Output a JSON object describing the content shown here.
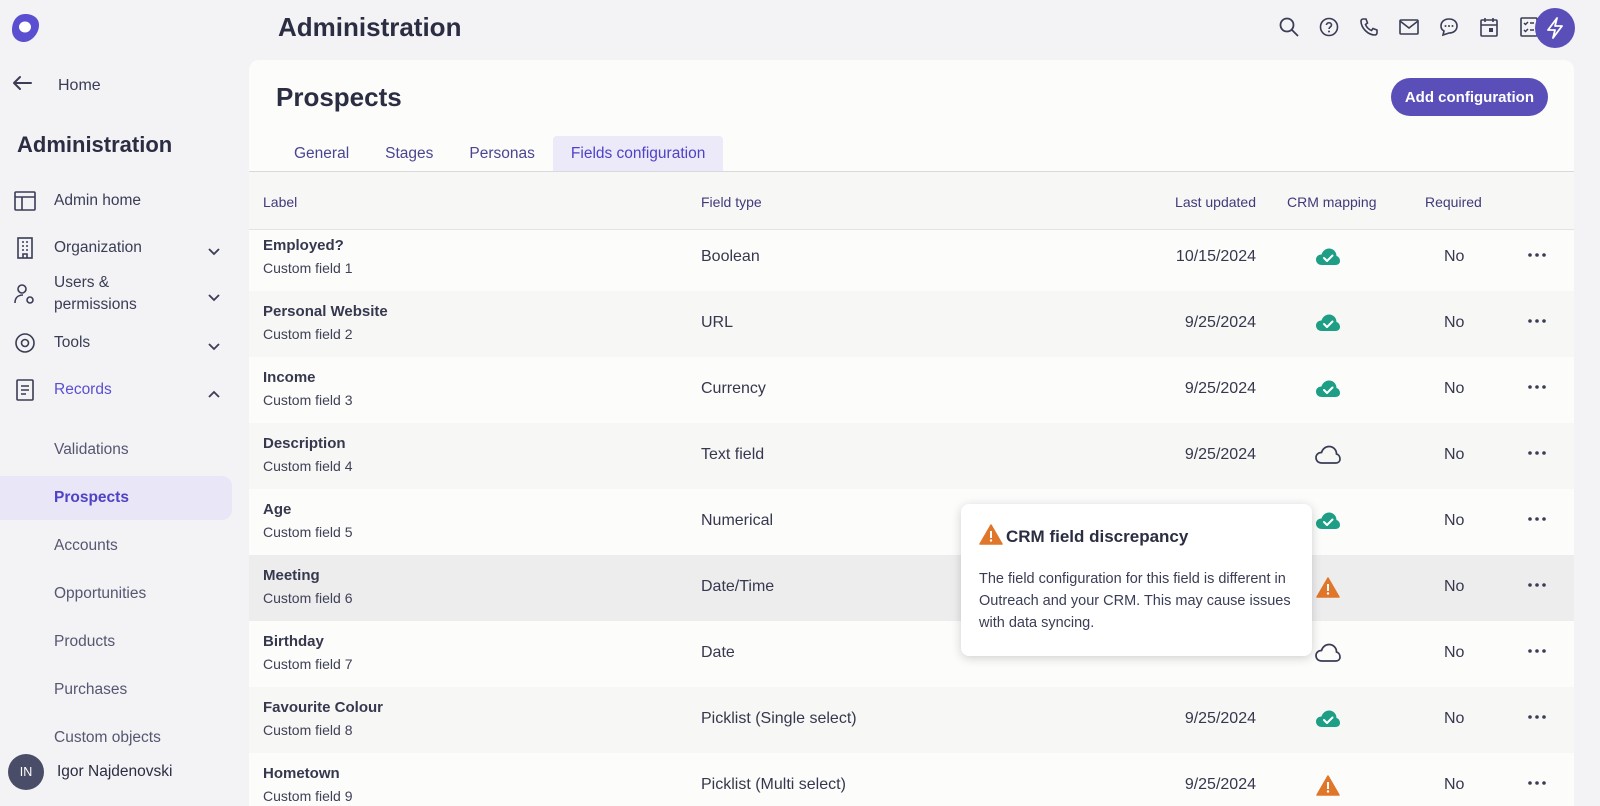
{
  "sidebar": {
    "home_label": "Home",
    "title": "Administration",
    "nav": [
      {
        "label": "Admin home",
        "icon": "layout-icon"
      },
      {
        "label": "Organization",
        "icon": "building-icon"
      },
      {
        "label": "Users & permissions",
        "icon": "user-gear-icon"
      },
      {
        "label": "Tools",
        "icon": "cog-icon"
      },
      {
        "label": "Records",
        "icon": "document-icon"
      }
    ],
    "records_sub": [
      "Validations",
      "Prospects",
      "Accounts",
      "Opportunities",
      "Products",
      "Purchases",
      "Custom objects"
    ],
    "selected_sub": "Prospects",
    "user": {
      "initials": "IN",
      "name": "Igor Najdenovski"
    }
  },
  "header": {
    "title": "Administration",
    "icons": [
      "search-icon",
      "help-icon",
      "phone-icon",
      "mail-icon",
      "chat-icon",
      "calendar-icon",
      "tasks-icon",
      "bolt-icon"
    ]
  },
  "main": {
    "title": "Prospects",
    "add_button": "Add configuration",
    "tabs": [
      "General",
      "Stages",
      "Personas",
      "Fields configuration"
    ],
    "active_tab": "Fields configuration",
    "columns": {
      "label": "Label",
      "field_type": "Field type",
      "last_updated": "Last updated",
      "crm_mapping": "CRM mapping",
      "required": "Required"
    },
    "rows": [
      {
        "name": "Employed?",
        "sub": "Custom field 1",
        "type": "Boolean",
        "date": "10/15/2024",
        "crm": "synced",
        "required": "No"
      },
      {
        "name": "Personal Website",
        "sub": "Custom field 2",
        "type": "URL",
        "date": "9/25/2024",
        "crm": "synced",
        "required": "No"
      },
      {
        "name": "Income",
        "sub": "Custom field 3",
        "type": "Currency",
        "date": "9/25/2024",
        "crm": "synced",
        "required": "No"
      },
      {
        "name": "Description",
        "sub": "Custom field 4",
        "type": "Text field",
        "date": "9/25/2024",
        "crm": "unmapped",
        "required": "No"
      },
      {
        "name": "Age",
        "sub": "Custom field 5",
        "type": "Numerical",
        "date": "",
        "crm": "synced",
        "required": "No"
      },
      {
        "name": "Meeting",
        "sub": "Custom field 6",
        "type": "Date/Time",
        "date": "",
        "crm": "warning",
        "required": "No"
      },
      {
        "name": "Birthday",
        "sub": "Custom field 7",
        "type": "Date",
        "date": "",
        "crm": "unmapped",
        "required": "No"
      },
      {
        "name": "Favourite Colour",
        "sub": "Custom field 8",
        "type": "Picklist (Single select)",
        "date": "9/25/2024",
        "crm": "synced",
        "required": "No"
      },
      {
        "name": "Hometown",
        "sub": "Custom field 9",
        "type": "Picklist (Multi select)",
        "date": "9/25/2024",
        "crm": "warning",
        "required": "No"
      }
    ]
  },
  "tooltip": {
    "title": "CRM field discrepancy",
    "body": "The field configuration for this field is different in Outreach and your CRM. This may cause issues with data syncing."
  },
  "colors": {
    "accent": "#5a4fb8",
    "synced": "#1f9e86",
    "warning": "#e0762a"
  }
}
